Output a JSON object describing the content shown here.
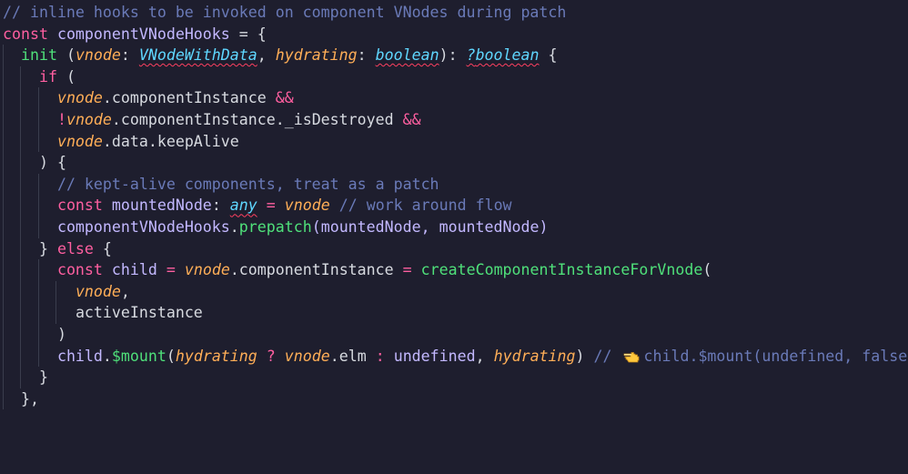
{
  "editor": {
    "colors": {
      "background": "#1e1e2e",
      "comment": "#6a7ab8",
      "keyword": "#ff5fa0",
      "function": "#4fe07a",
      "parameter": "#ffae57",
      "type": "#5fd7ff",
      "variable": "#c3b8ff",
      "text": "#d7dae0",
      "error_squiggle": "#ff4060"
    },
    "lines": {
      "l1": {
        "comment": "// inline hooks to be invoked on component VNodes during patch"
      },
      "l2": {
        "kw": "const",
        "name": "componentVNodeHooks",
        "rest": " = {"
      },
      "l3": {
        "fn": "init",
        "p1": "vnode",
        "t1": "VNodeWithData",
        "p2": "hydrating",
        "t2": "boolean",
        "ret_q": "?",
        "ret": "boolean"
      },
      "l4": {
        "kw": "if",
        "rest": " ("
      },
      "l5": {
        "obj": "vnode",
        "prop": ".componentInstance ",
        "op": "&&"
      },
      "l6": {
        "not": "!",
        "obj": "vnode",
        "prop": ".componentInstance._isDestroyed ",
        "op": "&&"
      },
      "l7": {
        "obj": "vnode",
        "prop": ".data.keepAlive"
      },
      "l8": {
        "text": ") {"
      },
      "l9": {
        "comment": "// kept-alive components, treat as a patch"
      },
      "l10": {
        "kw": "const",
        "name": "mountedNode",
        "type": "any",
        "obj": "vnode",
        "comment": "// work around flow"
      },
      "l11": {
        "obj": "componentVNodeHooks",
        "fn": "prepatch",
        "args": "(mountedNode, mountedNode)"
      },
      "l12": {
        "brace": "} ",
        "kw": "else",
        "rest": " {"
      },
      "l13": {
        "kw": "const",
        "name": "child",
        "obj": "vnode",
        "prop": ".componentInstance ",
        "fn": "createComponentInstanceForVnode",
        "rest": "("
      },
      "l14": {
        "obj": "vnode",
        "rest": ","
      },
      "l15": {
        "text": "activeInstance"
      },
      "l16": {
        "text": ")"
      },
      "l17": {
        "obj": "child",
        "fn": "$mount",
        "p1": "hydrating",
        "obj2": "vnode",
        "prop": ".elm",
        "undef": "undefined",
        "p2": "hydrating",
        "comment1": "//",
        "icon": "pointing-hand-icon",
        "comment2": "child.$mount(undefined, false)"
      },
      "l18": {
        "text": "}"
      },
      "l19": {
        "text": "},"
      }
    }
  }
}
